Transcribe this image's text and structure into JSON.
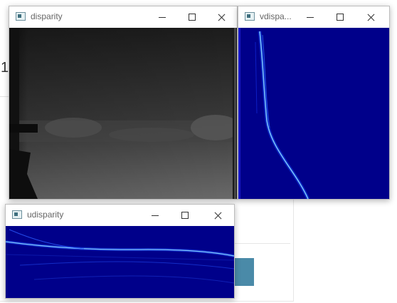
{
  "windows": {
    "disparity": {
      "title": "disparity"
    },
    "vdisparity": {
      "title": "vdispa..."
    },
    "udisparity": {
      "title": "udisparity"
    }
  },
  "background": {
    "glyph": "1"
  },
  "colors": {
    "map_background": "#00008a",
    "map_line": "#3aa0ff",
    "disparity_dark": "#1a1a1a",
    "disparity_mid": "#5a5a5a",
    "background_button": "#4a8aa8"
  }
}
